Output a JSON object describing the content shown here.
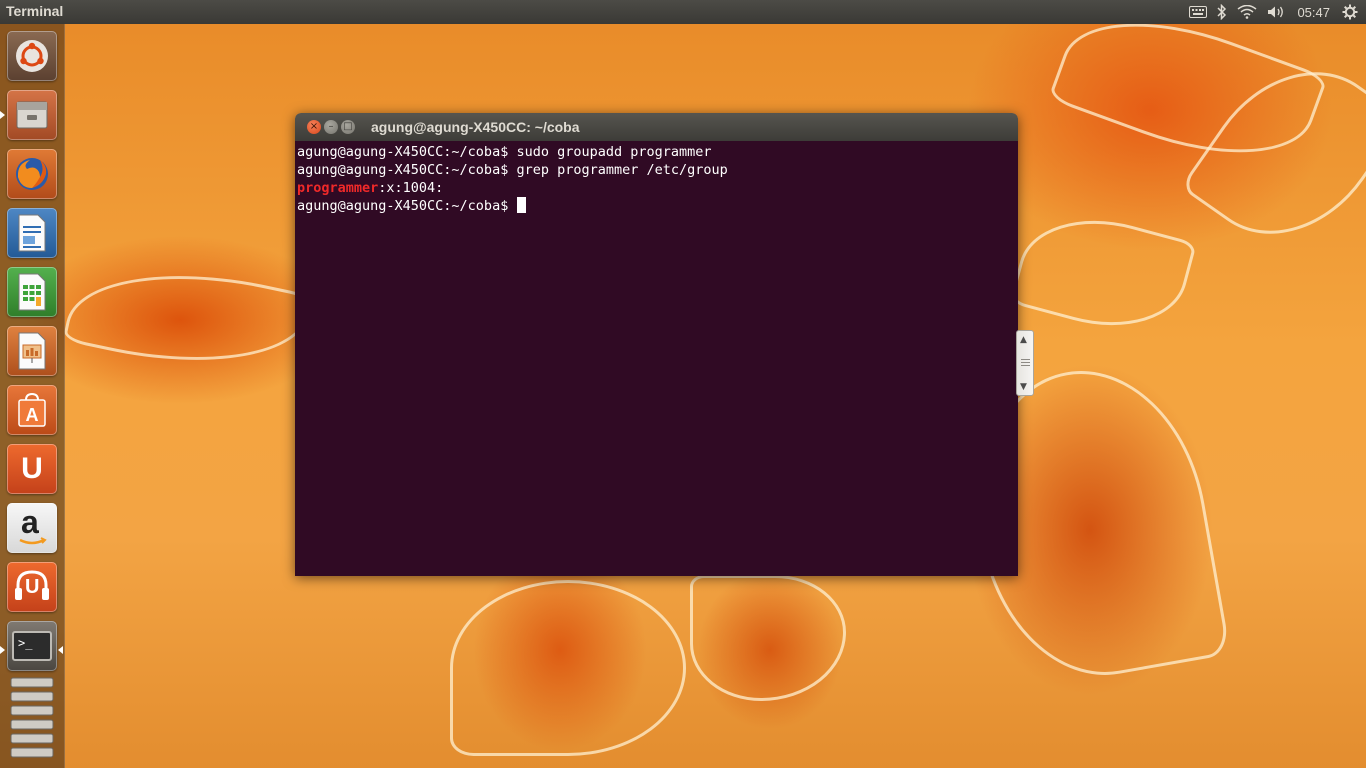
{
  "panel": {
    "app_title": "Terminal",
    "clock": "05:47",
    "indicators": [
      "keyboard-input-icon",
      "bluetooth-icon",
      "wifi-icon",
      "volume-icon",
      "gear-icon"
    ]
  },
  "launcher": {
    "items": [
      {
        "name": "ubuntu-dash-icon",
        "label": "Dash"
      },
      {
        "name": "files-icon",
        "label": "Files"
      },
      {
        "name": "firefox-icon",
        "label": "Firefox"
      },
      {
        "name": "libreoffice-writer-icon",
        "label": "Writer"
      },
      {
        "name": "libreoffice-calc-icon",
        "label": "Calc"
      },
      {
        "name": "libreoffice-impress-icon",
        "label": "Impress"
      },
      {
        "name": "software-center-icon",
        "label": "Software Center"
      },
      {
        "name": "ubuntu-one-icon",
        "label": "Ubuntu One"
      },
      {
        "name": "amazon-icon",
        "label": "Amazon"
      },
      {
        "name": "ubuntu-one-music-icon",
        "label": "Ubuntu One Music"
      },
      {
        "name": "terminal-icon",
        "label": "Terminal"
      },
      {
        "name": "workspace-switcher-icon",
        "label": "Workspaces"
      }
    ],
    "glyphs": {
      "software_center": "A",
      "ubuntu_one": "U",
      "amazon": "a",
      "ubuntu_one_music": "U",
      "terminal": ">_"
    }
  },
  "window": {
    "title": "agung@agung-X450CC: ~/coba",
    "buttons": {
      "close": "×",
      "minimize": "–",
      "maximize": "□"
    }
  },
  "terminal": {
    "lines": [
      "agung@agung-X450CC:~/coba$ sudo groupadd programmer",
      "agung@agung-X450CC:~/coba$ grep programmer /etc/group"
    ],
    "match_line": {
      "highlight": "programmer",
      "rest": ":x:1004:"
    },
    "prompt": "agung@agung-X450CC:~/coba$ "
  },
  "scrollbar": {
    "up": "▲",
    "down": "▼"
  },
  "colors": {
    "terminal_bg": "#300a24",
    "terminal_fg": "#ffffff",
    "grep_match": "#ef2929",
    "panel_bg": "#3c3b37",
    "close_button": "#e3582b"
  }
}
